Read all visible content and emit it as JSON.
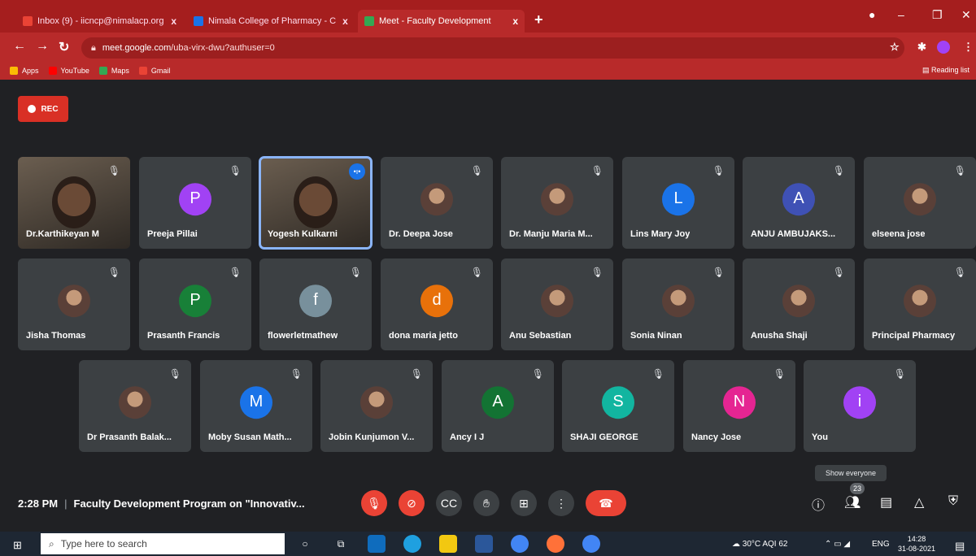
{
  "browser": {
    "tabs": [
      {
        "label": "Inbox (9) - iicncp@nimalacp.org",
        "color": "#ea4335"
      },
      {
        "label": "Nimala College of Pharmacy - C",
        "color": "#1a73e8"
      },
      {
        "label": "Meet - Faculty Development",
        "color": "#34a853"
      }
    ],
    "new_tab": "+",
    "url_host": "meet.google.com",
    "url_path": "/uba-virx-dwu?authuser=0",
    "bookmarks": [
      "Apps",
      "YouTube",
      "Maps",
      "Gmail"
    ],
    "reading_list": "Reading list",
    "tab_close": "x"
  },
  "meet": {
    "rec_label": "REC",
    "participants_row1": [
      {
        "name": "Dr.Karthikeyan M",
        "type": "video"
      },
      {
        "name": "Preeja Pillai",
        "initial": "P",
        "color": "#a142f4"
      },
      {
        "name": "Yogesh Kulkarni",
        "type": "video",
        "speaking": true
      },
      {
        "name": "Dr. Deepa Jose",
        "type": "photo"
      },
      {
        "name": "Dr. Manju Maria M...",
        "type": "photo"
      },
      {
        "name": "Lins Mary Joy",
        "initial": "L",
        "color": "#1a73e8"
      },
      {
        "name": "ANJU AMBUJAKS...",
        "initial": "A",
        "color": "#3f51b5"
      },
      {
        "name": "elseena jose",
        "type": "photo"
      }
    ],
    "participants_row2": [
      {
        "name": "Jisha Thomas",
        "type": "photo"
      },
      {
        "name": "Prasanth Francis",
        "initial": "P",
        "color": "#188038"
      },
      {
        "name": "flowerletmathew",
        "initial": "f",
        "color": "#78909c"
      },
      {
        "name": "dona maria jetto",
        "initial": "d",
        "color": "#e8710a"
      },
      {
        "name": "Anu Sebastian",
        "type": "photo"
      },
      {
        "name": "Sonia Ninan",
        "type": "photo"
      },
      {
        "name": "Anusha Shaji",
        "type": "photo"
      },
      {
        "name": "Principal Pharmacy",
        "type": "photo"
      }
    ],
    "participants_row3": [
      {
        "name": "Dr Prasanth Balak...",
        "type": "photo"
      },
      {
        "name": "Moby Susan Math...",
        "initial": "M",
        "color": "#1a73e8"
      },
      {
        "name": "Jobin Kunjumon V...",
        "type": "photo"
      },
      {
        "name": "Ancy I J",
        "initial": "A",
        "color": "#137333"
      },
      {
        "name": "SHAJI GEORGE",
        "initial": "S",
        "color": "#12b5a0"
      },
      {
        "name": "Nancy Jose",
        "initial": "N",
        "color": "#e52592"
      },
      {
        "name": "You",
        "initial": "i",
        "color": "#a142f4"
      }
    ],
    "time": "2:28 PM",
    "meeting_title": "Faculty Development Program on \"Innovativ...",
    "tooltip": "Show everyone",
    "participant_count": "23"
  },
  "taskbar": {
    "search_placeholder": "Type here to search",
    "weather": "30°C AQI 62",
    "lang": "ENG",
    "time": "14:28",
    "date": "31-08-2021"
  }
}
